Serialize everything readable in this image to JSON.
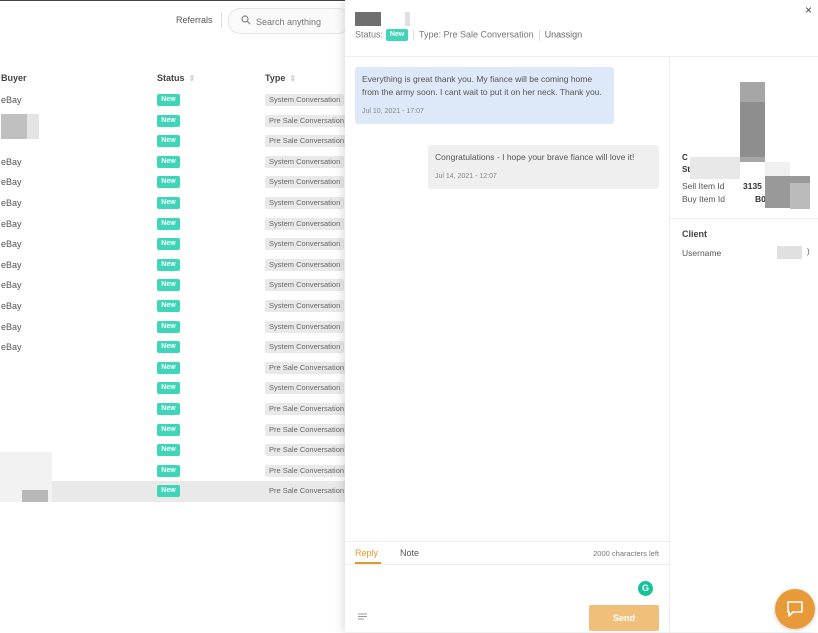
{
  "header": {
    "referrals": "Referrals",
    "search_placeholder": "Search anything"
  },
  "table": {
    "columns": [
      "Buyer",
      "Status",
      "Type"
    ],
    "rows": [
      {
        "buyer": "eBay",
        "status": "New",
        "type": "System Conversation"
      },
      {
        "buyer": "",
        "status": "New",
        "type": "Pre Sale Conversation"
      },
      {
        "buyer": "",
        "status": "New",
        "type": "Pre Sale Conversation"
      },
      {
        "buyer": "eBay",
        "status": "New",
        "type": "System Conversation"
      },
      {
        "buyer": "eBay",
        "status": "New",
        "type": "System Conversation"
      },
      {
        "buyer": "eBay",
        "status": "New",
        "type": "System Conversation"
      },
      {
        "buyer": "eBay",
        "status": "New",
        "type": "System Conversation"
      },
      {
        "buyer": "eBay",
        "status": "New",
        "type": "System Conversation"
      },
      {
        "buyer": "eBay",
        "status": "New",
        "type": "System Conversation"
      },
      {
        "buyer": "eBay",
        "status": "New",
        "type": "System Conversation"
      },
      {
        "buyer": "eBay",
        "status": "New",
        "type": "System Conversation"
      },
      {
        "buyer": "eBay",
        "status": "New",
        "type": "System Conversation"
      },
      {
        "buyer": "eBay",
        "status": "New",
        "type": "System Conversation"
      },
      {
        "buyer": "",
        "status": "New",
        "type": "Pre Sale Conversation"
      },
      {
        "buyer": "",
        "status": "New",
        "type": "System Conversation"
      },
      {
        "buyer": "",
        "status": "New",
        "type": "Pre Sale Conversation"
      },
      {
        "buyer": "",
        "status": "New",
        "type": "Pre Sale Conversation"
      },
      {
        "buyer": "",
        "status": "New",
        "type": "Pre Sale Conversation"
      },
      {
        "buyer": "",
        "status": "New",
        "type": "Pre Sale Conversation"
      },
      {
        "buyer": "",
        "status": "New",
        "type": "Pre Sale Conversation"
      }
    ]
  },
  "conversation": {
    "status_label": "Status:",
    "status_badge": "New",
    "type_label": "Type: Pre Sale Conversation",
    "unassign": "Unassign",
    "close": "×",
    "messages": [
      {
        "text": "Everything is great thank you. My fiance will be coming home from the army soon. I cant wait to put it on her neck. Thank you.",
        "time": "Jul 10, 2021 - 17:07",
        "direction": "in"
      },
      {
        "text": "Congratulations - I hope your brave fiance will love it!",
        "time": "Jul 14, 2021 - 12:07",
        "direction": "out"
      }
    ],
    "reply_tab": "Reply",
    "note_tab": "Note",
    "chars_left": "2000 characters left",
    "grammarly": "G",
    "send": "Send"
  },
  "details": {
    "label_c": "C",
    "label_s": "St",
    "sell_item_label": "Sell Item Id",
    "sell_item_value": "3135",
    "buy_item_label": "Buy Item Id",
    "buy_item_value": "B0",
    "client_heading": "Client",
    "username_label": "Username",
    "username_tail": ")"
  },
  "colors": {
    "accent": "#e99a38",
    "badge": "#3fd5b8",
    "incoming_bubble": "#dde8f8"
  }
}
